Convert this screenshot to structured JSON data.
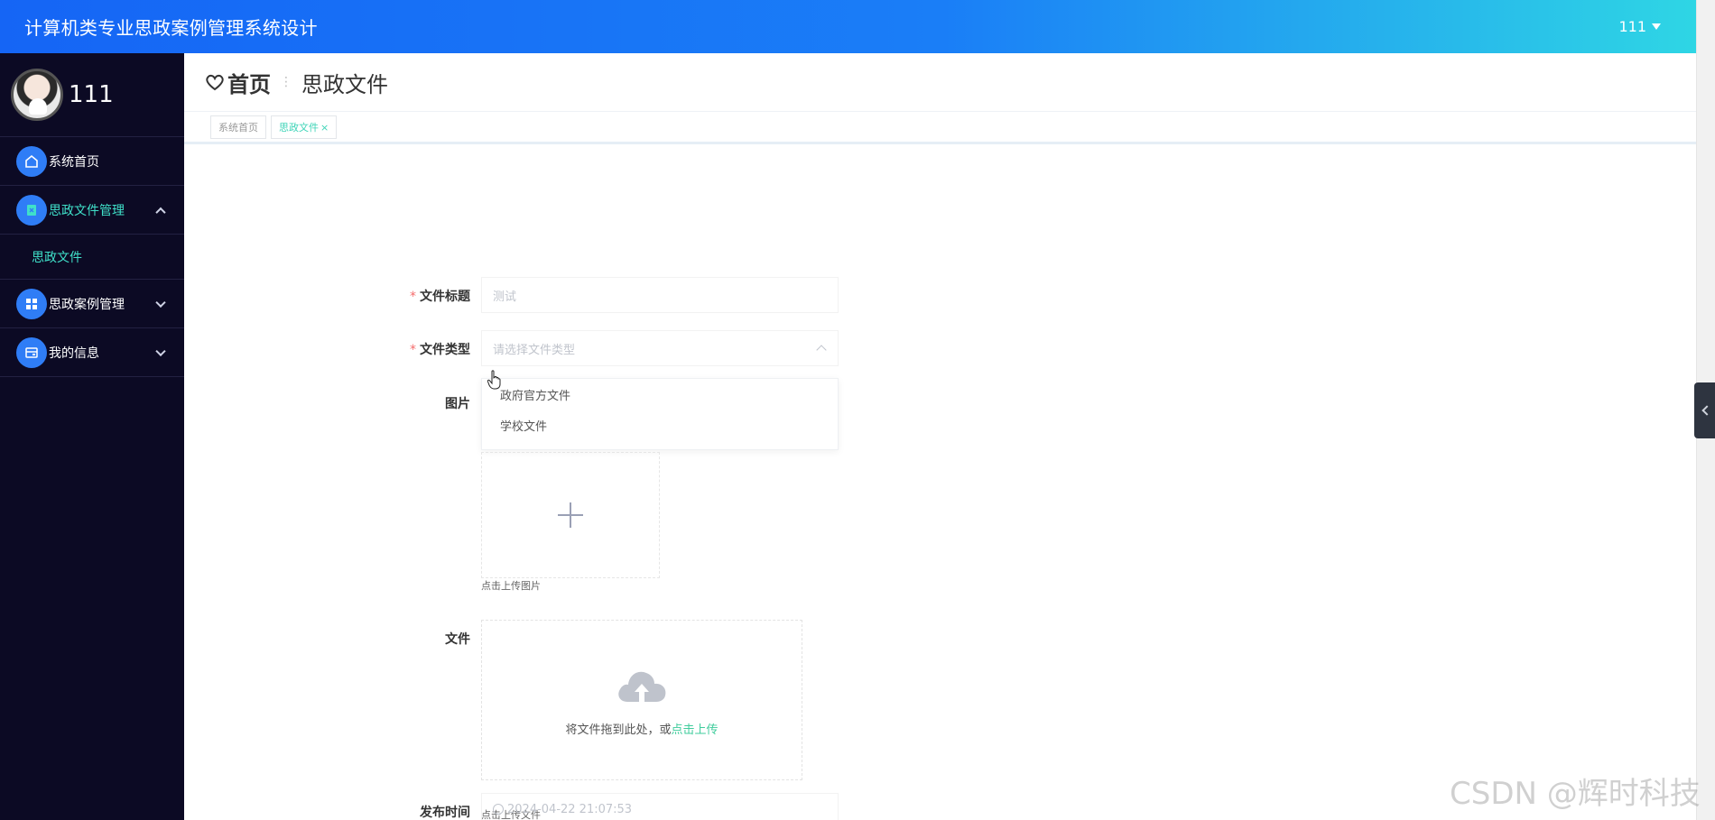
{
  "header": {
    "app_title": "计算机类专业思政案例管理系统设计",
    "user_label": "111"
  },
  "sidebar": {
    "profile_name": "111",
    "items": [
      {
        "label": "系统首页",
        "icon": "home-icon"
      },
      {
        "label": "思政文件管理",
        "icon": "document-icon",
        "expanded": true
      },
      {
        "label": "思政案例管理",
        "icon": "grid-icon"
      },
      {
        "label": "我的信息",
        "icon": "card-icon"
      }
    ],
    "submenu": {
      "label": "思政文件"
    }
  },
  "breadcrumb": {
    "home": "首页",
    "current": "思政文件"
  },
  "tabs": [
    {
      "label": "系统首页"
    },
    {
      "label": "思政文件",
      "close": "×"
    }
  ],
  "form": {
    "title_label": "文件标题",
    "title_value": "测试",
    "type_label": "文件类型",
    "type_placeholder": "请选择文件类型",
    "type_options": [
      "政府官方文件",
      "学校文件"
    ],
    "image_label": "图片",
    "image_hint": "点击上传图片",
    "file_label": "文件",
    "file_drag_text": "将文件拖到此处，或",
    "file_drag_link": "点击上传",
    "file_hint": "点击上传文件",
    "time_label": "发布时间",
    "time_value": "2024-04-22 21:07:53"
  },
  "watermark": "CSDN @辉时科技",
  "colors": {
    "header_start": "#1565f5",
    "header_end": "#2fd8e4",
    "sidebar_bg": "#0c0a24",
    "accent": "#3fe0c9",
    "icon_bg": "#2f7df6",
    "required": "#f56c6c"
  }
}
